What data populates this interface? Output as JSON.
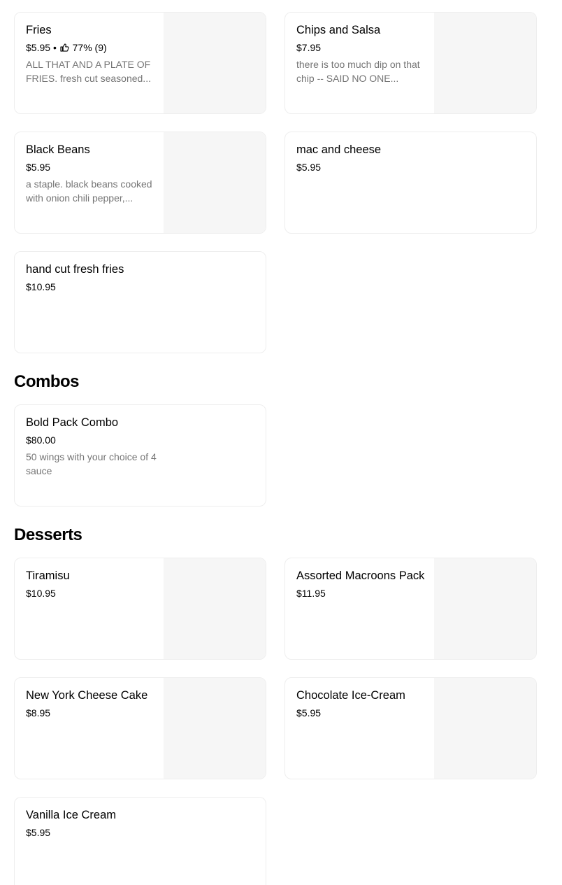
{
  "items_top": {
    "fries": {
      "name": "Fries",
      "price": "$5.95",
      "sep": "•",
      "rating": "77% (9)",
      "desc": "ALL THAT AND A PLATE OF FRIES. fresh cut seasoned..."
    },
    "chips": {
      "name": "Chips and Salsa",
      "price": "$7.95",
      "desc": "there is too much dip on that chip -- SAID NO ONE..."
    },
    "beans": {
      "name": "Black Beans",
      "price": "$5.95",
      "desc": "a staple. black beans cooked with onion chili pepper,..."
    },
    "mac": {
      "name": "mac and cheese",
      "price": "$5.95"
    },
    "handcut": {
      "name": "hand cut fresh fries",
      "price": "$10.95"
    }
  },
  "combos": {
    "title": "Combos",
    "bold_pack": {
      "name": "Bold Pack Combo",
      "price": "$80.00",
      "desc": "50 wings with your choice of 4 sauce"
    }
  },
  "desserts": {
    "title": "Desserts",
    "tiramisu": {
      "name": "Tiramisu",
      "price": "$10.95"
    },
    "macroons": {
      "name": "Assorted Macroons Pack",
      "price": "$11.95"
    },
    "cheesecake": {
      "name": "New York Cheese Cake",
      "price": "$8.95"
    },
    "choc": {
      "name": "Chocolate Ice-Cream",
      "price": "$5.95"
    },
    "vanilla": {
      "name": "Vanilla Ice Cream",
      "price": "$5.95"
    }
  }
}
